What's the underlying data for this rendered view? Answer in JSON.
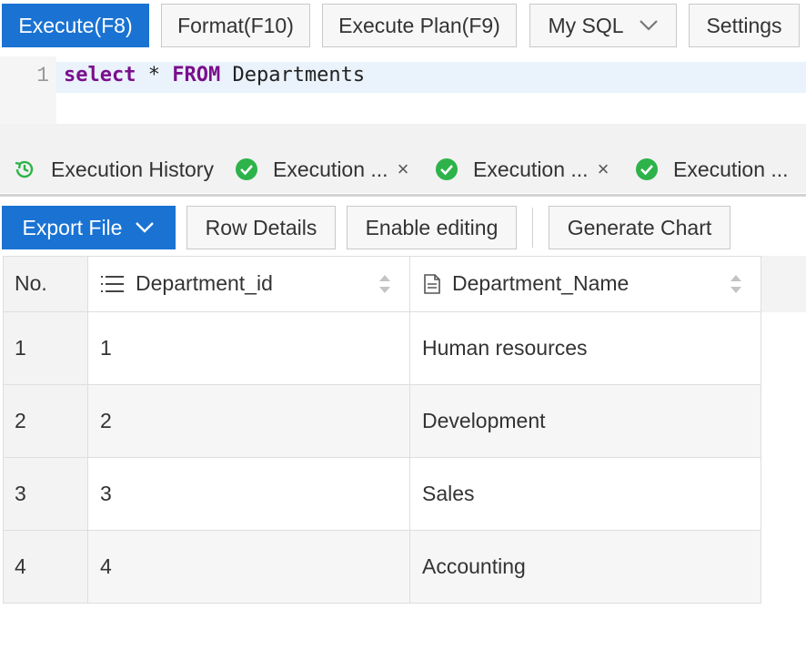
{
  "toolbar": {
    "execute_label": "Execute(F8)",
    "format_label": "Format(F10)",
    "plan_label": "Execute Plan(F9)",
    "dialect_label": "My SQL",
    "settings_label": "Settings"
  },
  "editor": {
    "line_number": "1",
    "keyword_select": "select",
    "star": " * ",
    "keyword_from": "FROM",
    "table_name": " Departments"
  },
  "history": {
    "title": "Execution History",
    "tabs": [
      {
        "label": "Execution ...",
        "close": "×"
      },
      {
        "label": "Execution ...",
        "close": "×"
      },
      {
        "label": "Execution ..."
      }
    ]
  },
  "result_toolbar": {
    "export_label": "Export File",
    "row_details_label": "Row Details",
    "enable_editing_label": "Enable editing",
    "generate_chart_label": "Generate Chart"
  },
  "grid": {
    "headers": [
      "No.",
      "Department_id",
      "Department_Name"
    ],
    "rows": [
      [
        "1",
        "1",
        "Human resources"
      ],
      [
        "2",
        "2",
        "Development"
      ],
      [
        "3",
        "3",
        "Sales"
      ],
      [
        "4",
        "4",
        "Accounting"
      ]
    ]
  },
  "colors": {
    "primary": "#1a73d3",
    "success": "#2db34a",
    "keyword": "#7a0f8c"
  }
}
